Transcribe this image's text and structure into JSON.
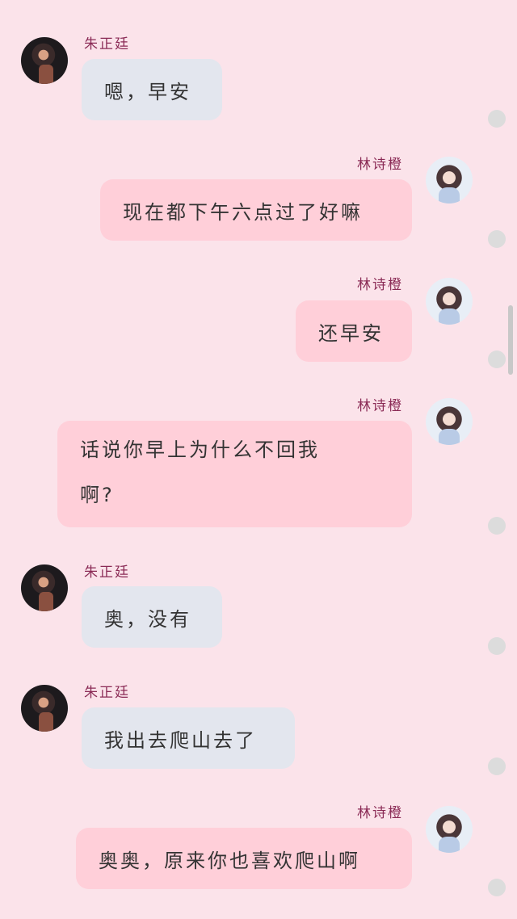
{
  "messages": [
    {
      "sender": "朱正廷",
      "side": "left",
      "text": "嗯，早安"
    },
    {
      "sender": "林诗橙",
      "side": "right",
      "text": "现在都下午六点过了好嘛"
    },
    {
      "sender": "林诗橙",
      "side": "right",
      "text": "还早安"
    },
    {
      "sender": "林诗橙",
      "side": "right",
      "text": "话说你早上为什么不回我啊?",
      "line1": "话说你早上为什么不回我",
      "line2": "啊?"
    },
    {
      "sender": "朱正廷",
      "side": "left",
      "text": "奥，没有"
    },
    {
      "sender": "朱正廷",
      "side": "left",
      "text": "我出去爬山去了"
    },
    {
      "sender": "林诗橙",
      "side": "right",
      "text": "奥奥，原来你也喜欢爬山啊"
    }
  ]
}
